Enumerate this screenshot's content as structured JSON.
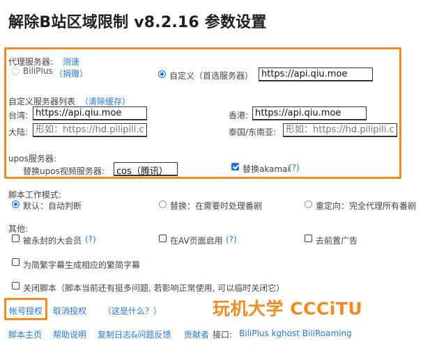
{
  "page": {
    "title": "解除B站区域限制 v8.2.16 参数设置"
  },
  "proxy": {
    "label": "代理服务器:",
    "test_link": "测速",
    "biliplus_label": "BiliPlus",
    "donate_link": "（捐赠）",
    "custom_label": "自定义（首选服务器）",
    "custom_value": "https://api.qiu.moe"
  },
  "custom_list": {
    "label": "自定义服务器列表",
    "clear_link": "（清除缓存）",
    "taiwan_label": "台湾:",
    "taiwan_value": "https://api.qiu.moe",
    "hongkong_label": "香港:",
    "hongkong_value": "https://api.qiu.moe",
    "mainland_label": "大陆:",
    "mainland_placeholder": "形如：https://hd.pilipili.com",
    "thailand_label": "泰国/东南亚:",
    "thailand_placeholder": "形如：https://hd.pilipili.com"
  },
  "upos": {
    "label": "upos服务器:",
    "replace_label": "替换upos视频服务器:",
    "selected": "cos（腾讯）",
    "akamai_label": "替换akamai",
    "akamai_help": "(?)"
  },
  "mode": {
    "label": "脚本工作模式:",
    "default_label": "默认：自动判断",
    "replace_label": "替换：在需要时处理番剧",
    "redirect_label": "重定向：完全代理所有番剧"
  },
  "other": {
    "label": "其他:",
    "banned_label": "被永封的大会员",
    "banned_help": "(?)",
    "av_label": "在AV页面启用",
    "av_help": "(?)",
    "ads_label": "去前置广告",
    "subtitle_label": "为简繁字幕生成相应的繁简字幕",
    "disable_label": "关闭脚本（脚本当前还有挺多问题, 若影响正常使用, 可以临时关闭它）"
  },
  "auth": {
    "authorize": "帐号授权",
    "revoke": "取消授权",
    "what": "（这是什么？）"
  },
  "watermark": "玩机大学 CCCiTU",
  "footer": {
    "home": "脚本主页",
    "help": "帮助说明",
    "copy_log": "复制日志&问题反馈",
    "contributors": "贡献者",
    "api_label": "接口:",
    "api_list": "BiliPlus kghost BiliRoaming"
  },
  "colors": {
    "accent": "#f28a23",
    "link": "#2a78d6",
    "check": "#1a73e8"
  }
}
